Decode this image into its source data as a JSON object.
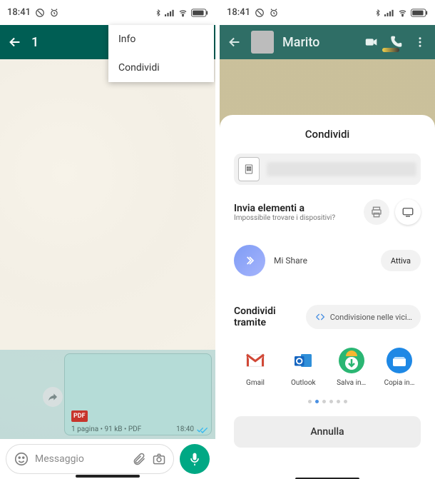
{
  "left": {
    "statusbar": {
      "time": "18:41"
    },
    "header": {
      "back": "←",
      "count": "1"
    },
    "menu": {
      "info": "Info",
      "share": "Condividi"
    },
    "message": {
      "badge": "PDF",
      "meta": "1 pagina • 91 kB • PDF",
      "time": "18:40"
    },
    "composer": {
      "placeholder": "Messaggio"
    }
  },
  "right": {
    "statusbar": {
      "time": "18:41"
    },
    "header": {
      "name": "Marito"
    },
    "sheet": {
      "title": "Condividi",
      "send_to": "Invia elementi a",
      "send_sub": "Impossibile trovare i dispositivi?",
      "mishare": "Mi Share",
      "activate": "Attiva",
      "via": "Condividi tramite",
      "nearby": "Condivisione nelle vici…",
      "apps": [
        {
          "label": "Gmail"
        },
        {
          "label": "Outlook"
        },
        {
          "label": "Salva in…"
        },
        {
          "label": "Copia in…"
        }
      ],
      "cancel": "Annulla"
    }
  }
}
